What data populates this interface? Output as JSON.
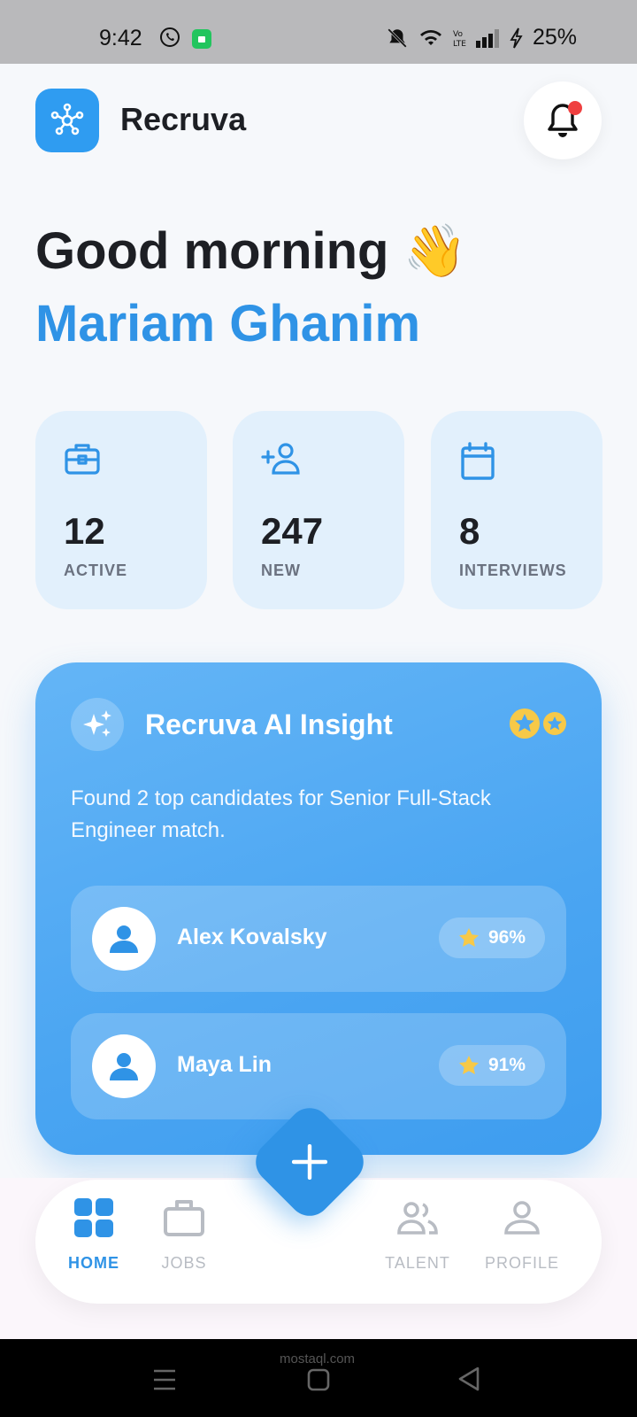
{
  "status_bar": {
    "time": "9:42",
    "battery": "25%"
  },
  "header": {
    "app_name": "Recruva"
  },
  "greeting": {
    "line1": "Good morning",
    "emoji": "👋",
    "name": "Mariam Ghanim"
  },
  "stats": [
    {
      "icon": "briefcase-icon",
      "value": "12",
      "label": "ACTIVE"
    },
    {
      "icon": "add-person-icon",
      "value": "247",
      "label": "NEW"
    },
    {
      "icon": "calendar-icon",
      "value": "8",
      "label": "INTERVIEWS"
    }
  ],
  "ai_insight": {
    "title": "Recruva AI Insight",
    "text": "Found 2 top candidates for Senior Full-Stack Engineer match.",
    "candidates": [
      {
        "name": "Alex Kovalsky",
        "score": "96%"
      },
      {
        "name": "Maya Lin",
        "score": "91%"
      }
    ]
  },
  "nav": {
    "items": [
      {
        "label": "HOME",
        "active": true
      },
      {
        "label": "JOBS",
        "active": false
      },
      {
        "label": "TALENT",
        "active": false
      },
      {
        "label": "PROFILE",
        "active": false
      }
    ]
  },
  "watermark": "mostaql.com",
  "colors": {
    "accent": "#2f93e6",
    "card_bg": "#e2f0fc",
    "notification": "#ef4040",
    "star": "#f7c948"
  }
}
